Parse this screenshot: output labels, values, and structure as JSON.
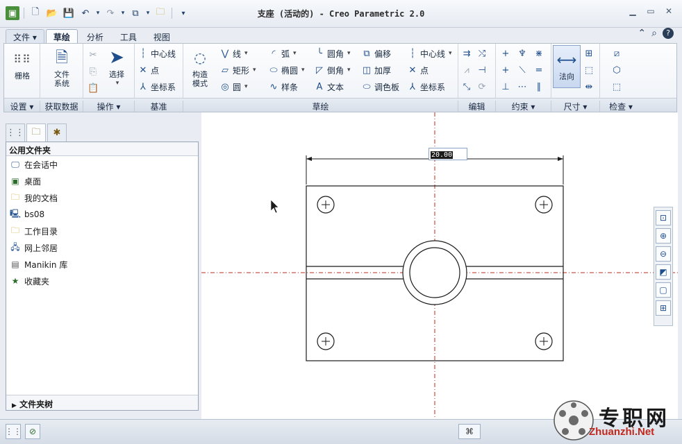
{
  "window": {
    "title": "支座 (活动的) - Creo Parametric 2.0"
  },
  "tabs": [
    {
      "label": "文件 ▾"
    },
    {
      "label": "草绘"
    },
    {
      "label": "分析"
    },
    {
      "label": "工具"
    },
    {
      "label": "视图"
    }
  ],
  "ribbon": {
    "setup": {
      "grid": "栅格",
      "label": "设置 ▾"
    },
    "getdata": {
      "file_system_1": "文件",
      "file_system_2": "系统",
      "label": "获取数据"
    },
    "operations": {
      "select": "选择",
      "label": "操作 ▾"
    },
    "datum": {
      "centerline": "中心线",
      "point": "点",
      "coordsys": "坐标系",
      "label": "基准"
    },
    "sketch": {
      "construct_1": "构造",
      "construct_2": "模式",
      "line": "线",
      "rectangle": "矩形",
      "circle": "圆",
      "arc": "弧",
      "ellipse": "椭圆",
      "spline": "样条",
      "fillet": "圆角",
      "chamfer": "倒角",
      "text": "文本",
      "offset": "偏移",
      "thicken": "加厚",
      "palette": "调色板",
      "centerline": "中心线",
      "point": "点",
      "coordsys": "坐标系",
      "label": "草绘"
    },
    "edit": {
      "label": "编辑"
    },
    "constraints": {
      "label": "约束 ▾"
    },
    "dimension": {
      "normal": "法向",
      "label": "尺寸 ▾"
    },
    "inspect": {
      "label": "检查 ▾"
    }
  },
  "left_panel": {
    "header": "公用文件夹",
    "items": [
      {
        "label": "在会话中"
      },
      {
        "label": "桌面"
      },
      {
        "label": "我的文档"
      },
      {
        "label": "bs08"
      },
      {
        "label": "工作目录"
      },
      {
        "label": "网上邻居"
      },
      {
        "label": "Manikin 库"
      },
      {
        "label": "收藏夹"
      }
    ],
    "tree_toggle": "文件夹树"
  },
  "sketch": {
    "dimension_value": "20.00"
  },
  "watermark": {
    "text": "专职网",
    "url": "Zhuanzhi.Net"
  },
  "colors": {
    "accent": "#1f4e8c",
    "centerline": "#c0281d"
  }
}
